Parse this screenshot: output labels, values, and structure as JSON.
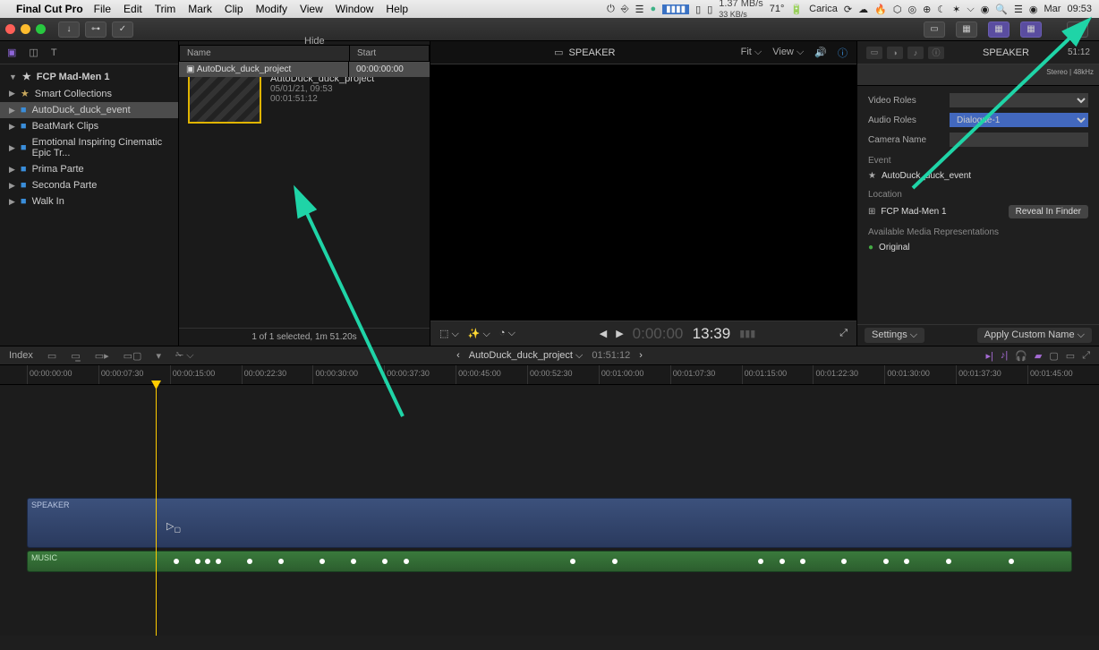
{
  "menubar": {
    "app": "Final Cut Pro",
    "items": [
      "File",
      "Edit",
      "Trim",
      "Mark",
      "Clip",
      "Modify",
      "View",
      "Window",
      "Help"
    ],
    "right": {
      "net_up": "1.37 MB/s",
      "net_down": "33 KB/s",
      "temp": "71°",
      "battery": "Carica",
      "day": "Mar",
      "time": "09:53"
    }
  },
  "sidebar": {
    "library": "FCP Mad-Men 1",
    "items": [
      {
        "label": "Smart Collections",
        "icon": "star"
      },
      {
        "label": "AutoDuck_duck_event",
        "icon": "clip",
        "selected": true
      },
      {
        "label": "BeatMark Clips",
        "icon": "clip"
      },
      {
        "label": "Emotional Inspiring Cinematic Epic Tr...",
        "icon": "clip"
      },
      {
        "label": "Prima Parte",
        "icon": "clip"
      },
      {
        "label": "Seconda Parte",
        "icon": "clip"
      },
      {
        "label": "Walk In",
        "icon": "clip"
      }
    ]
  },
  "browser": {
    "hide_label": "Hide Rejected",
    "clip": {
      "name": "AutoDuck_duck_project",
      "date": "05/01/21, 09:53",
      "dur": "00:01:51:12"
    },
    "columns": {
      "name": "Name",
      "start": "Start"
    },
    "rows": [
      {
        "name": "AutoDuck_duck_project",
        "start": "00:00:00:00"
      }
    ],
    "footer": "1 of 1 selected, 1m 51.20s"
  },
  "viewer": {
    "title": "SPEAKER",
    "fit": "Fit",
    "view": "View",
    "tc_gray": "0:00:00",
    "tc": "13:39"
  },
  "inspector": {
    "title": "SPEAKER",
    "timecode": "51:12",
    "audio_meta": "Stereo | 48kHz",
    "video_roles": "Video Roles",
    "audio_roles": "Audio Roles",
    "audio_roles_val": "Dialogue-1",
    "camera_name": "Camera Name",
    "event_label": "Event",
    "event_val": "AutoDuck_duck_event",
    "location_label": "Location",
    "location_val": "FCP Mad-Men 1",
    "reveal": "Reveal In Finder",
    "avail_label": "Available Media Representations",
    "original": "Original",
    "settings": "Settings",
    "apply_name": "Apply Custom Name"
  },
  "timeline": {
    "index": "Index",
    "project": "AutoDuck_duck_project",
    "duration": "01:51:12",
    "ticks": [
      "00:00:00:00",
      "00:00:07:30",
      "00:00:15:00",
      "00:00:22:30",
      "00:00:30:00",
      "00:00:37:30",
      "00:00:45:00",
      "00:00:52:30",
      "00:01:00:00",
      "00:01:07:30",
      "00:01:15:00",
      "00:01:22:30",
      "00:01:30:00",
      "00:01:37:30",
      "00:01:45:00"
    ],
    "speaker_label": "SPEAKER",
    "music_label": "MUSIC"
  }
}
